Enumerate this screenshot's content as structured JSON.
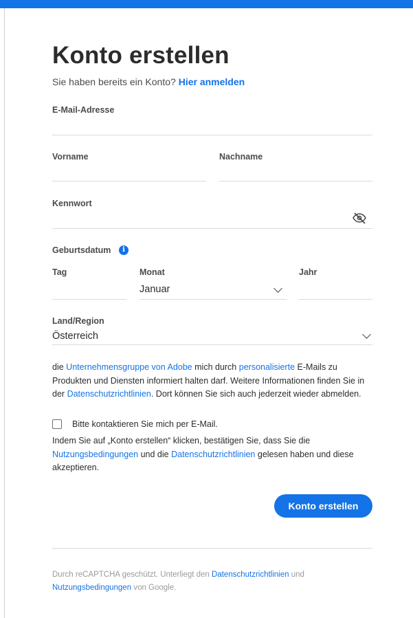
{
  "header": {
    "title": "Konto erstellen",
    "subtitle_text": "Sie haben bereits ein Konto?",
    "signin_link": "Hier anmelden"
  },
  "form": {
    "email_label": "E-Mail-Adresse",
    "email_value": "",
    "firstname_label": "Vorname",
    "firstname_value": "",
    "lastname_label": "Nachname",
    "lastname_value": "",
    "password_label": "Kennwort",
    "password_value": "",
    "birthdate_label": "Geburtsdatum",
    "day_label": "Tag",
    "day_value": "",
    "month_label": "Monat",
    "month_value": "Januar",
    "year_label": "Jahr",
    "year_value": "",
    "country_label": "Land/Region",
    "country_value": "Österreich"
  },
  "consent": {
    "p1_a": "die",
    "p1_link1": "Unternehmensgruppe von Adobe",
    "p1_b": "mich durch",
    "p1_link2": "personalisierte",
    "p1_c": "E-Mails zu Produkten und Diensten informiert halten darf. Weitere Informationen finden Sie in der",
    "p1_link3": "Datenschutzrichtlinien",
    "p1_d": ". Dort können Sie sich auch jederzeit wieder abmelden.",
    "checkbox_label": "Bitte kontaktieren Sie mich per E-Mail.",
    "checkbox_checked": false,
    "p2_a": "Indem Sie auf „Konto erstellen“ klicken, bestätigen Sie, dass Sie die",
    "p2_link1": "Nutzungsbedingungen",
    "p2_b": "und die",
    "p2_link2": "Datenschutzrichtlinien",
    "p2_c": "gelesen haben und diese akzeptieren."
  },
  "submit_label": "Konto erstellen",
  "recaptcha": {
    "a": "Durch reCAPTCHA geschützt. Unterliegt den",
    "link1": "Datenschutzrichtlinien",
    "b": "und",
    "link2": "Nutzungsbedingungen",
    "c": "von Google."
  },
  "icons": {
    "password_toggle": "eye-slash-icon",
    "info": "info-icon",
    "dropdown": "chevron-down-icon"
  },
  "colors": {
    "accent": "#1473e6",
    "text": "#2c2c2c",
    "muted": "#9a9a9a",
    "divider": "#dadada"
  }
}
